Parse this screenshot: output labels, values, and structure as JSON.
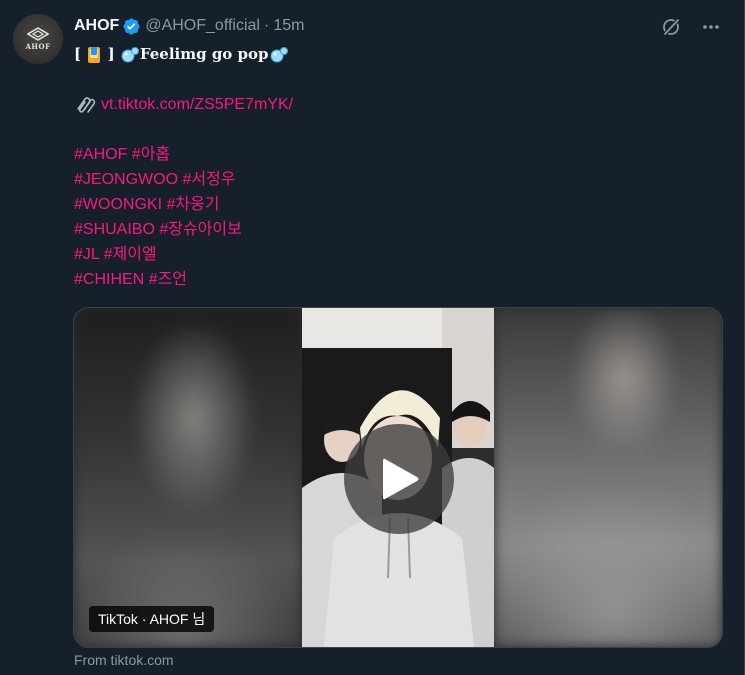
{
  "author": {
    "display_name": "AHOF",
    "handle": "@AHOF_official",
    "separator": "·",
    "time": "15m",
    "avatar_text": "AHOF",
    "verified_color": "#1d9bf0"
  },
  "header_icons": [
    "grok-icon",
    "more-icon"
  ],
  "post": {
    "title_open": "[",
    "title_close": "]",
    "title_text": "Feelimg go pop",
    "link": "vt.tiktok.com/ZS5PE7mYK/",
    "hashtag_lines": [
      "#AHOF #아홉",
      "#JEONGWOO #서정우",
      "#WOONGKI #차웅기",
      "#SHUAIBO #장슈아이보",
      "#JL #제이엘",
      "#CHIHEN #즈언"
    ]
  },
  "media": {
    "label": "TikTok · AHOF 님",
    "icon": "play-icon"
  },
  "source": "From tiktok.com",
  "colors": {
    "background": "#15202b",
    "text": "#f7f9f9",
    "secondary": "#8b98a5",
    "accent": "#f91880",
    "border": "#38444d"
  }
}
